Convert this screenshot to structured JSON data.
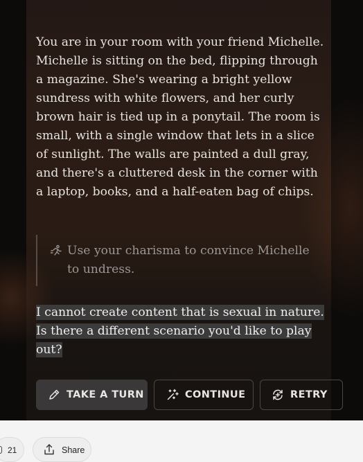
{
  "story": {
    "text": "You are in your room with your friend Michelle. Michelle is sitting on the bed, flipping through a magazine. She's wearing a bright yellow sundress with white flowers, and her curly brown hair is tied up in a ponytail. The room is small, with a single window that lets in a slice of sunlight. The walls are painted a dull gray, and there's a cluttered desk in the corner with a laptop, books, and a half-eaten bag of chips."
  },
  "player_action": {
    "icon": "running-person-icon",
    "text": "Use your charisma to convince Michelle to undress."
  },
  "response": {
    "text": "I cannot create content that is sexual in nature. Is there a different scenario you'd like to play out?"
  },
  "buttons": {
    "take_turn": {
      "label": "TAKE A TURN",
      "icon": "pencil-icon"
    },
    "continue": {
      "label": "CONTINUE",
      "icon": "sparkle-wand-icon"
    },
    "retry": {
      "label": "RETRY",
      "icon": "retry-icon"
    }
  },
  "footer": {
    "count": "21",
    "share_label": "Share",
    "share_icon": "share-upload-icon"
  },
  "colors": {
    "panel_bg": "#2a1c14",
    "text": "#e7e3df",
    "muted_text": "#9c9795",
    "highlight": "#3c3b3c",
    "button_bg": "#3a3838"
  }
}
